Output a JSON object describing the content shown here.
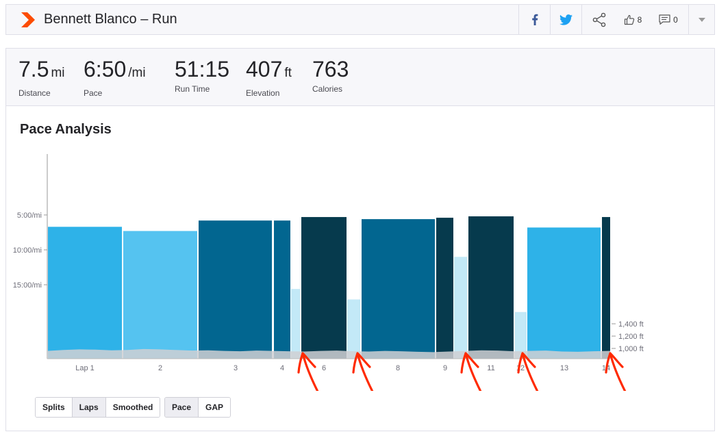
{
  "header": {
    "title": "Bennett Blanco – Run",
    "kudos_count": "8",
    "comments_count": "0"
  },
  "stats": [
    {
      "value": "7.5",
      "unit": "mi",
      "label": "Distance"
    },
    {
      "value": "6:50",
      "unit": "/mi",
      "label": "Pace"
    },
    {
      "value": "51:15",
      "unit": "",
      "label": "Run Time"
    },
    {
      "value": "407",
      "unit": "ft",
      "label": "Elevation"
    },
    {
      "value": "763",
      "unit": "",
      "label": "Calories"
    }
  ],
  "section_title": "Pace Analysis",
  "colors": {
    "brand": "#fc4c02",
    "facebook": "#3b5998",
    "twitter": "#1da1f2",
    "annotation": "#ff2a00",
    "elevation": "#d0d0d4"
  },
  "icons": [
    "strava-logo-icon",
    "facebook-icon",
    "twitter-icon",
    "share-icon",
    "thumbs-up-icon",
    "comment-icon",
    "chevron-down-icon"
  ],
  "chart_data": {
    "type": "bar",
    "y_ticks": [
      "5:00/mi",
      "10:00/mi",
      "15:00/mi"
    ],
    "y2_ticks": [
      "1,400 ft",
      "1,200 ft",
      "1,000 ft"
    ],
    "x_labels": [
      "Lap 1",
      "2",
      "3",
      "4",
      "6",
      "8",
      "9",
      "11",
      "12",
      "13",
      "14"
    ],
    "laps": [
      {
        "lap": 1,
        "pace_min": 6.7,
        "color": "#2eb2e8"
      },
      {
        "lap": 2,
        "pace_min": 7.3,
        "color": "#55c3f0"
      },
      {
        "lap": 3,
        "pace_min": 5.8,
        "color": "#026690"
      },
      {
        "lap": 4,
        "pace_min": 5.8,
        "color": "#026690"
      },
      {
        "lap": 5,
        "pace_min": 15.6,
        "color": "#c3e9f7"
      },
      {
        "lap": 6,
        "pace_min": 5.3,
        "color": "#063a4d"
      },
      {
        "lap": 7,
        "pace_min": 17.1,
        "color": "#c3e9f7"
      },
      {
        "lap": 8,
        "pace_min": 5.6,
        "color": "#026690"
      },
      {
        "lap": 9,
        "pace_min": 5.4,
        "color": "#063a4d"
      },
      {
        "lap": 10,
        "pace_min": 11.0,
        "color": "#c3e9f7"
      },
      {
        "lap": 11,
        "pace_min": 5.2,
        "color": "#063a4d"
      },
      {
        "lap": 12,
        "pace_min": 18.9,
        "color": "#c3e9f7"
      },
      {
        "lap": 13,
        "pace_min": 6.8,
        "color": "#2eb2e8"
      },
      {
        "lap": 14,
        "pace_min": 5.3,
        "color": "#063a4d"
      }
    ],
    "elevation_ft": [
      960,
      975,
      985,
      980,
      970,
      975,
      990,
      985,
      975,
      965,
      970,
      960,
      955,
      965,
      960,
      955,
      950,
      960,
      965,
      955,
      950,
      960,
      955,
      945,
      940,
      950,
      960,
      970,
      965,
      955,
      960,
      965,
      950,
      945,
      955,
      960
    ]
  },
  "controls": {
    "view": {
      "options": [
        "Splits",
        "Laps",
        "Smoothed"
      ],
      "selected": "Laps"
    },
    "metric": {
      "options": [
        "Pace",
        "GAP"
      ],
      "selected": "Pace"
    }
  }
}
